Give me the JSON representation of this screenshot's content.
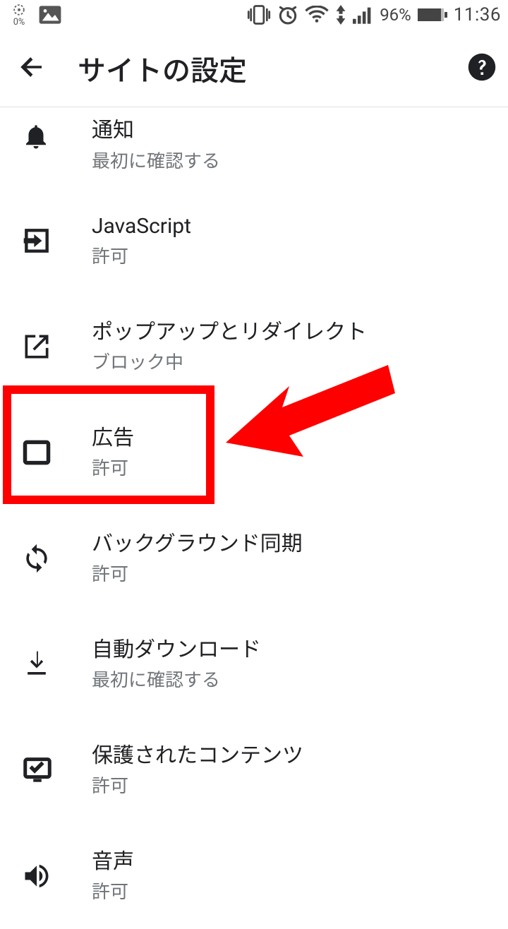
{
  "status": {
    "data_saver_pct": "0%",
    "battery_pct": "96%",
    "time": "11:36"
  },
  "header": {
    "title": "サイトの設定"
  },
  "items": [
    {
      "title": "通知",
      "sub": "最初に確認する"
    },
    {
      "title": "JavaScript",
      "sub": "許可"
    },
    {
      "title": "ポップアップとリダイレクト",
      "sub": "ブロック中"
    },
    {
      "title": "広告",
      "sub": "許可"
    },
    {
      "title": "バックグラウンド同期",
      "sub": "許可"
    },
    {
      "title": "自動ダウンロード",
      "sub": "最初に確認する"
    },
    {
      "title": "保護されたコンテンツ",
      "sub": "許可"
    },
    {
      "title": "音声",
      "sub": "許可"
    }
  ]
}
